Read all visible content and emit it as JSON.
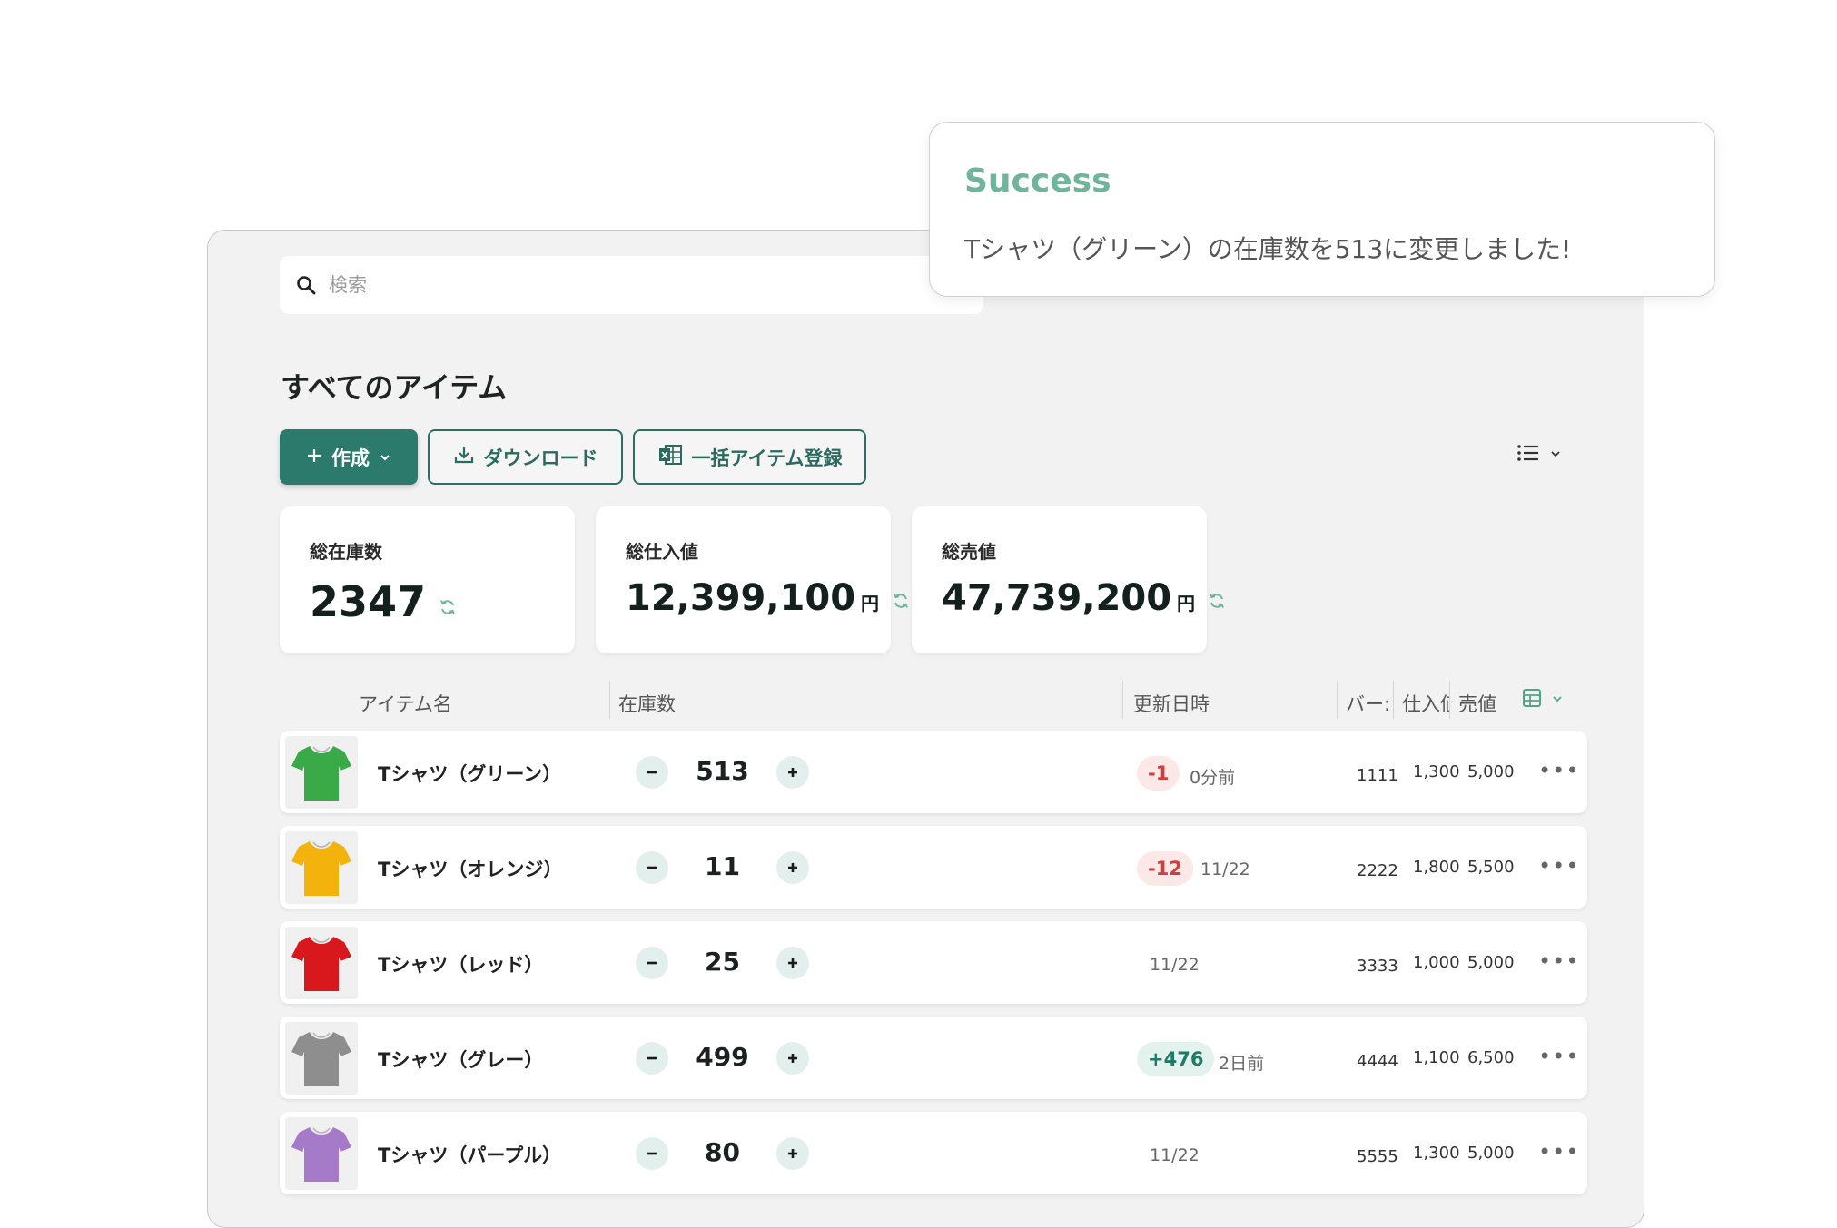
{
  "search": {
    "placeholder": "検索"
  },
  "page_title": "すべてのアイテム",
  "toolbar": {
    "create_label": "作成",
    "download_label": "ダウンロード",
    "bulk_label": "一括アイテム登録"
  },
  "summary": [
    {
      "label": "総在庫数",
      "value": "2347",
      "unit": ""
    },
    {
      "label": "総仕入値",
      "value": "12,399,100",
      "unit": "円"
    },
    {
      "label": "総売値",
      "value": "47,739,200",
      "unit": "円"
    }
  ],
  "table": {
    "headers": {
      "name": "アイテム名",
      "stock": "在庫数",
      "updated": "更新日時",
      "barcode": "バー:",
      "cost": "仕入値",
      "price": "売値"
    },
    "rows": [
      {
        "name": "Tシャツ（グリーン）",
        "qty": "513",
        "badge": "-1",
        "badge_type": "neg",
        "time": "0分前",
        "barcode": "1111",
        "cost": "1,300",
        "price": "5,000",
        "color": "#3aaa48"
      },
      {
        "name": "Tシャツ（オレンジ）",
        "qty": "11",
        "badge": "-12",
        "badge_type": "neg",
        "time": "11/22",
        "barcode": "2222",
        "cost": "1,800",
        "price": "5,500",
        "color": "#f3b30c"
      },
      {
        "name": "Tシャツ（レッド）",
        "qty": "25",
        "badge": "",
        "badge_type": "",
        "time": "11/22",
        "barcode": "3333",
        "cost": "1,000",
        "price": "5,000",
        "color": "#d8181d"
      },
      {
        "name": "Tシャツ（グレー）",
        "qty": "499",
        "badge": "+476",
        "badge_type": "pos",
        "time": "2日前",
        "barcode": "4444",
        "cost": "1,100",
        "price": "6,500",
        "color": "#8e8e8e"
      },
      {
        "name": "Tシャツ（パープル）",
        "qty": "80",
        "badge": "",
        "badge_type": "",
        "time": "11/22",
        "barcode": "5555",
        "cost": "1,300",
        "price": "5,000",
        "color": "#a57ac9"
      }
    ]
  },
  "toast": {
    "title": "Success",
    "message": "Tシャツ（グリーン）の在庫数を513に変更しました!"
  },
  "colors": {
    "accent": "#2b7a6c",
    "success": "#6fb59a",
    "negative": "#d53b3b",
    "positive": "#1f7a67"
  },
  "icons": {
    "search": "search-icon",
    "plus": "plus-icon",
    "chevron": "chevron-down-icon",
    "download": "download-icon",
    "excel": "excel-icon",
    "list": "list-view-icon",
    "refresh": "refresh-icon",
    "columns": "columns-icon",
    "more": "more-icon"
  }
}
